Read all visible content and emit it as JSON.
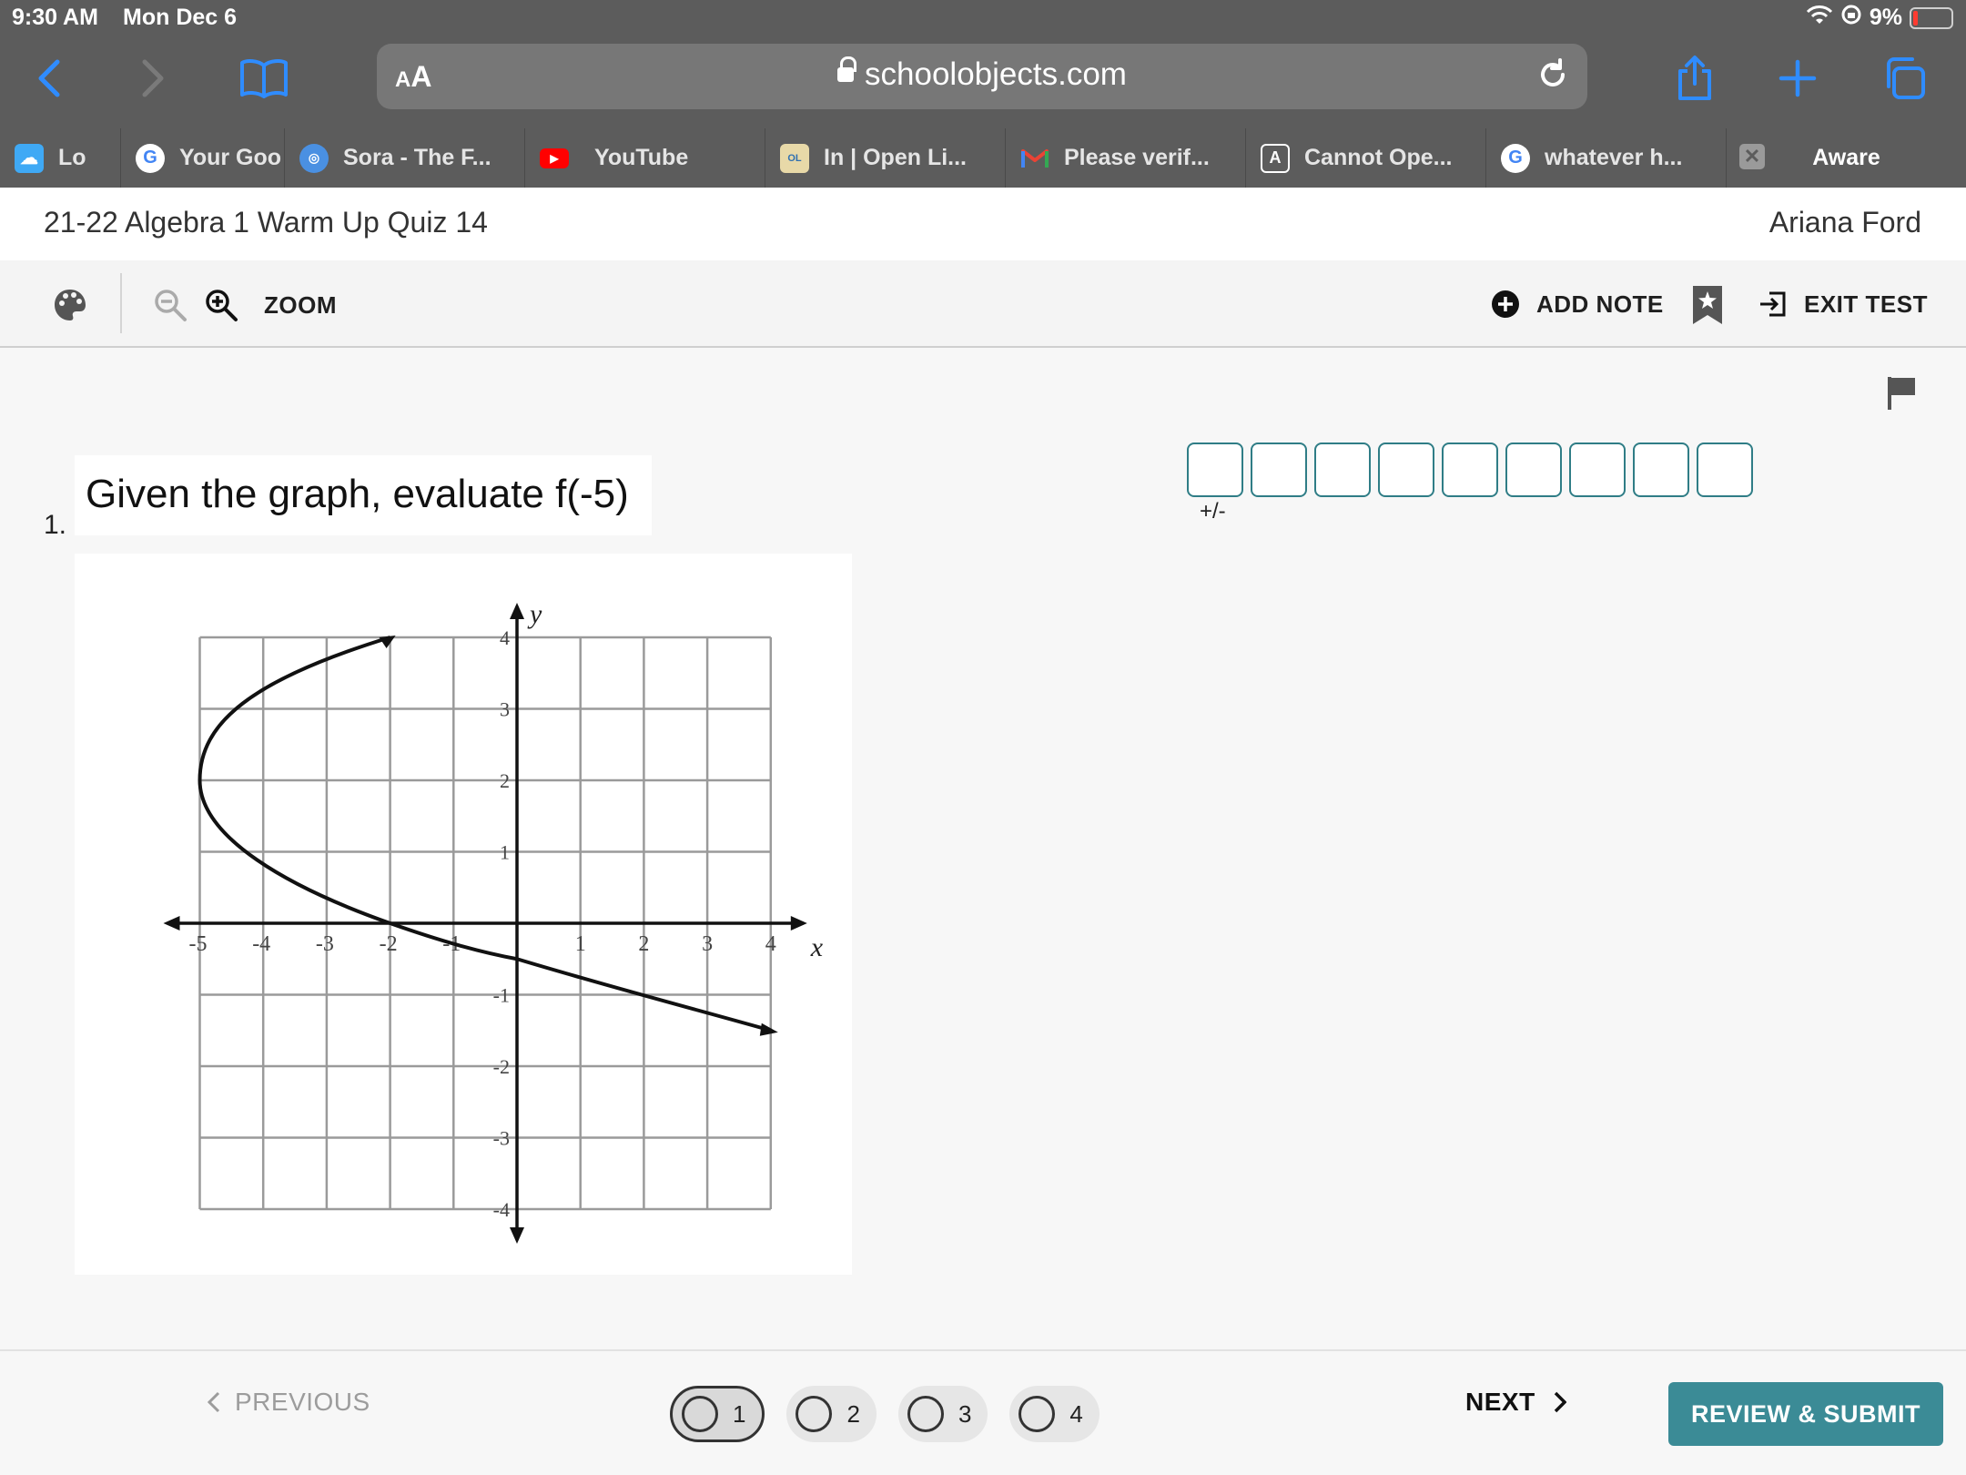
{
  "status_bar": {
    "time": "9:30 AM",
    "date": "Mon Dec 6",
    "battery": "9%"
  },
  "browser": {
    "aa_label": "AA",
    "url": "schoolobjects.com",
    "tabs": [
      {
        "label": "Lo",
        "favicon": "cloud-icon",
        "color": "#3fa9f5"
      },
      {
        "label": "Your Goo",
        "favicon": "google-icon",
        "color": "#ffffff"
      },
      {
        "label": "Sora - The F...",
        "favicon": "sora-icon",
        "color": "#4a90e2"
      },
      {
        "label": "YouTube",
        "favicon": "youtube-icon",
        "color": "#ff0000"
      },
      {
        "label": "In | Open Li...",
        "favicon": "openlibrary-icon",
        "color": "#e8d9a8"
      },
      {
        "label": "Please verif...",
        "favicon": "gmail-icon",
        "color": "#ffffff"
      },
      {
        "label": "Cannot Ope...",
        "favicon": "a-icon",
        "color": "#5c5c5c"
      },
      {
        "label": "whatever h...",
        "favicon": "google-icon",
        "color": "#ffffff"
      },
      {
        "label": "Aware",
        "favicon": "close-icon",
        "color": "#9a9a9a"
      }
    ]
  },
  "header": {
    "quiz_title": "21-22 Algebra 1 Warm Up Quiz 14",
    "user_name": "Ariana Ford"
  },
  "toolbar": {
    "zoom_label": "ZOOM",
    "add_note_label": "ADD NOTE",
    "exit_label": "EXIT TEST"
  },
  "question": {
    "number": "1.",
    "text": "Given the graph, evaluate f(-5)",
    "sign_label": "+/-",
    "answer_box_count": 9
  },
  "graph": {
    "x_label": "x",
    "y_label": "y",
    "x_ticks": [
      "-5",
      "-4",
      "-3",
      "-2",
      "-1",
      "1",
      "2",
      "3",
      "4"
    ],
    "y_ticks": [
      "4",
      "3",
      "2",
      "1",
      "-1",
      "-2",
      "-3",
      "-4"
    ],
    "xlim": [
      -5,
      4
    ],
    "ylim": [
      -4,
      4
    ],
    "curve_points": [
      [
        -2,
        4
      ],
      [
        -5,
        2
      ],
      [
        -2,
        0
      ],
      [
        0,
        -0.5
      ],
      [
        4,
        -1.5
      ]
    ]
  },
  "footer": {
    "previous_label": "PREVIOUS",
    "pages": [
      "1",
      "2",
      "3",
      "4"
    ],
    "current_page": "1",
    "next_label": "NEXT",
    "review_label": "REVIEW & SUBMIT"
  }
}
